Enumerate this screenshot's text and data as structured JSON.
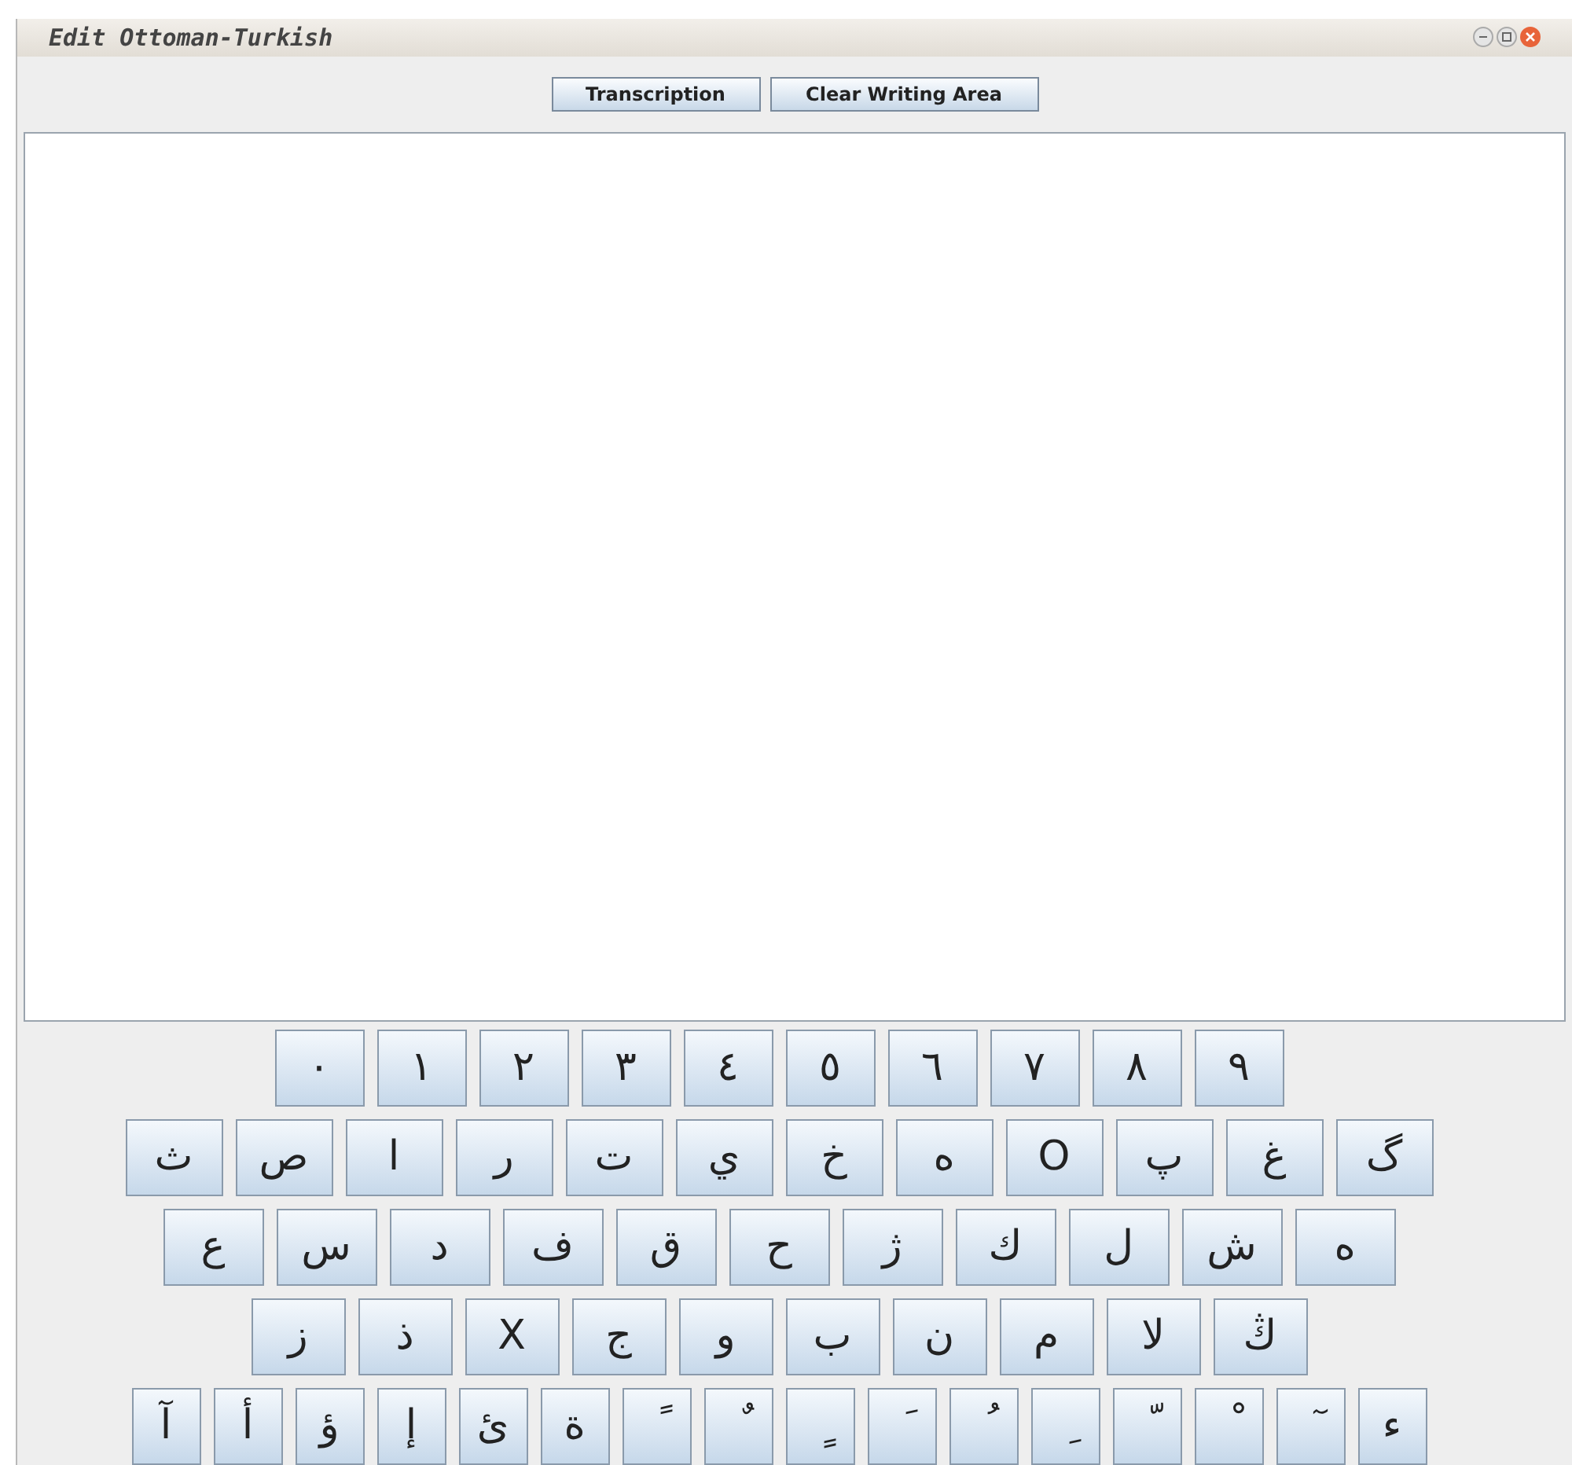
{
  "window": {
    "title": "Edit Ottoman-Turkish"
  },
  "toolbar": {
    "buttons": [
      "Transcription",
      "Clear Writing Area"
    ]
  },
  "keyboard": {
    "rows": [
      {
        "keys": [
          "٩",
          "٨",
          "٧",
          "٦",
          "٥",
          "٤",
          "٣",
          "٢",
          "١",
          "٠"
        ]
      },
      {
        "keys": [
          "گ",
          "غ",
          "پ",
          "O",
          "ه",
          "خ",
          "ي",
          "ت",
          "ر",
          "ا",
          "ص",
          "ث"
        ]
      },
      {
        "keys": [
          "ه",
          "ش",
          "ل",
          "ك",
          "ژ",
          "ح",
          "ق",
          "ف",
          "د",
          "س",
          "ع"
        ]
      },
      {
        "keys": [
          "ڭ",
          "لا",
          "م",
          "ن",
          "ب",
          "و",
          "ج",
          "X",
          "ذ",
          "ز"
        ]
      },
      {
        "keys": [
          "ء",
          "ٓ",
          "ْ",
          "ّ",
          "ِ",
          "ُ",
          "َ",
          "ٍ",
          "ٌ",
          "ً",
          "ة",
          "ئ",
          "إ",
          "ؤ",
          "أ",
          "آ"
        ]
      }
    ]
  }
}
